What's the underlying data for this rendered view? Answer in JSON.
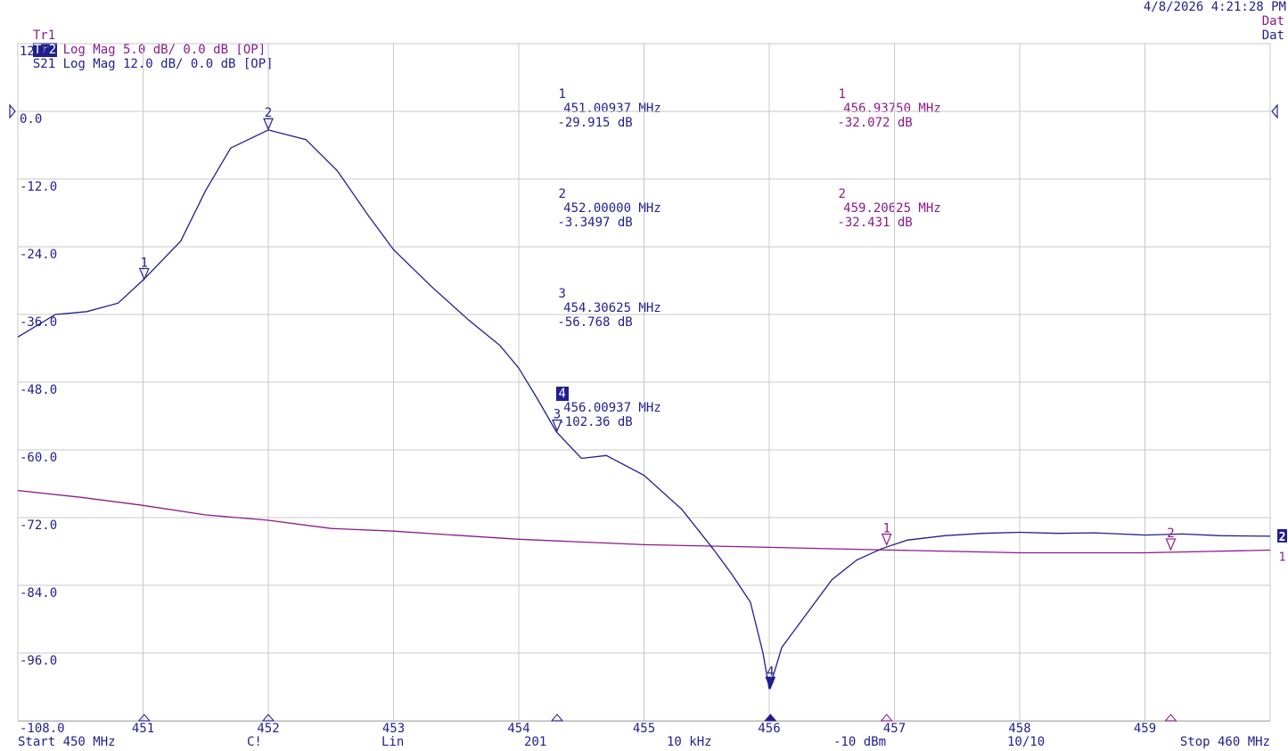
{
  "timestamp": "4/8/2026 4:21:28 PM",
  "traces": [
    {
      "chip": "Tr1",
      "desc": "S11 Log Mag 5.0 dB/ 0.0 dB [OP]",
      "status": "Dat"
    },
    {
      "chip": "Tr2",
      "desc": "S21 Log Mag 12.0 dB/ 0.0 dB [OP]",
      "status": "Dat"
    }
  ],
  "marker_table_tr2": [
    {
      "num": "1",
      "freq": "451.00937 MHz",
      "val": "-29.915 dB",
      "active": false
    },
    {
      "num": "2",
      "freq": "452.00000 MHz",
      "val": "-3.3497 dB",
      "active": false
    },
    {
      "num": "3",
      "freq": "454.30625 MHz",
      "val": "-56.768 dB",
      "active": false
    },
    {
      "num": "4",
      "freq": "456.00937 MHz",
      "val": "-102.36 dB",
      "active": true
    }
  ],
  "marker_table_tr1": [
    {
      "num": "1",
      "freq": "456.93750 MHz",
      "val": "-32.072 dB"
    },
    {
      "num": "2",
      "freq": "459.20625 MHz",
      "val": "-32.431 dB"
    }
  ],
  "status_bar": {
    "start": "Start 450 MHz",
    "cal": "C!",
    "sweep": "Lin",
    "points": "201",
    "ifbw": "10 kHz",
    "power": "-10 dBm",
    "avg": "10/10",
    "stop": "Stop 460 MHz"
  },
  "colors": {
    "tr1": "#8b1a8b",
    "tr2": "#1f1f8f",
    "grid": "#c8c8c8"
  },
  "chart_data": {
    "type": "line",
    "x_range": [
      450,
      460
    ],
    "ylim": [
      -108,
      12
    ],
    "grid": true,
    "x_ticks": [
      "451",
      "452",
      "453",
      "454",
      "455",
      "456",
      "457",
      "458",
      "459"
    ],
    "y_ticks": [
      "12.0",
      "0.0",
      "-12.0",
      "-24.0",
      "-36.0",
      "-48.0",
      "-60.0",
      "-72.0",
      "-84.0",
      "-96.0",
      "-108.0"
    ],
    "series": [
      {
        "name": "S21",
        "color": "#1f1f8f",
        "x": [
          450,
          450.3,
          450.55,
          450.8,
          451.0,
          451.3,
          451.5,
          451.7,
          452.0,
          452.3,
          452.55,
          452.8,
          453.0,
          453.3,
          453.6,
          453.85,
          454.0,
          454.15,
          454.3,
          454.5,
          454.7,
          455.0,
          455.3,
          455.55,
          455.7,
          455.85,
          455.95,
          456.0,
          456.1,
          456.2,
          456.35,
          456.5,
          456.7,
          456.9,
          457.1,
          457.4,
          457.7,
          458.0,
          458.3,
          458.6,
          459.0,
          459.3,
          459.6,
          460
        ],
        "y": [
          -40.0,
          -36.0,
          -35.5,
          -34.0,
          -29.9,
          -23.0,
          -14.0,
          -6.5,
          -3.3,
          -5.0,
          -10.5,
          -18.5,
          -24.5,
          -31.0,
          -37.0,
          -41.5,
          -45.5,
          -51.0,
          -56.8,
          -61.5,
          -61.0,
          -64.5,
          -70.5,
          -77.5,
          -82.0,
          -87.0,
          -96.0,
          -102.4,
          -95.0,
          -92.0,
          -87.5,
          -83.0,
          -79.5,
          -77.5,
          -76.0,
          -75.2,
          -74.8,
          -74.6,
          -74.8,
          -74.7,
          -75.1,
          -74.9,
          -75.2,
          -75.3
        ]
      },
      {
        "name": "S11",
        "color": "#8b1a8b",
        "scale_db_per_div": 5.0,
        "x": [
          450,
          450.5,
          451,
          451.5,
          452,
          452.5,
          453,
          453.5,
          454,
          454.5,
          455,
          455.5,
          456,
          456.5,
          457,
          457.5,
          458,
          458.5,
          459,
          459.5,
          460
        ],
        "y": [
          -28.0,
          -28.5,
          -29.1,
          -29.8,
          -30.2,
          -30.8,
          -31.0,
          -31.3,
          -31.6,
          -31.8,
          -32.0,
          -32.1,
          -32.2,
          -32.3,
          -32.4,
          -32.5,
          -32.6,
          -32.6,
          -32.6,
          -32.5,
          -32.4
        ]
      }
    ],
    "markers": [
      {
        "trace": "S21",
        "label": "1",
        "x": 451.00937,
        "y": -29.915,
        "active": false
      },
      {
        "trace": "S21",
        "label": "2",
        "x": 452.0,
        "y": -3.3497,
        "active": false
      },
      {
        "trace": "S21",
        "label": "3",
        "x": 454.30625,
        "y": -56.768,
        "active": false
      },
      {
        "trace": "S21",
        "label": "4",
        "x": 456.00937,
        "y": -102.36,
        "active": true
      },
      {
        "trace": "S11",
        "label": "1",
        "x": 456.9375,
        "y": -32.072,
        "active": false
      },
      {
        "trace": "S11",
        "label": "2",
        "x": 459.20625,
        "y": -32.431,
        "active": false
      }
    ],
    "ref_flags": [
      {
        "label": "2",
        "trace": "S21"
      },
      {
        "label": "1",
        "trace": "S11"
      }
    ]
  }
}
